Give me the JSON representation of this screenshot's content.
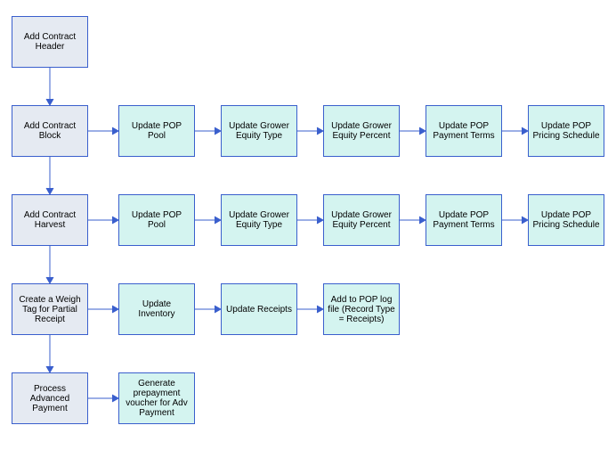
{
  "nodes": {
    "add_contract_header": "Add Contract Header",
    "add_contract_block": "Add Contract Block",
    "add_contract_harvest": "Add Contract Harvest",
    "create_weigh_tag": "Create a Weigh Tag for Partial Receipt",
    "process_adv_payment": "Process Advanced Payment",
    "row2": {
      "update_pop_pool": "Update POP Pool",
      "update_grower_equity_type": "Update Grower Equity Type",
      "update_grower_equity_percent": "Update Grower Equity Percent",
      "update_pop_payment_terms": "Update POP Payment Terms",
      "update_pop_pricing_schedule": "Update POP Pricing Schedule"
    },
    "row3": {
      "update_pop_pool": "Update POP Pool",
      "update_grower_equity_type": "Update Grower Equity Type",
      "update_grower_equity_percent": "Update Grower Equity Percent",
      "update_pop_payment_terms": "Update POP Payment Terms",
      "update_pop_pricing_schedule": "Update POP Pricing Schedule"
    },
    "row4": {
      "update_inventory": "Update Inventory",
      "update_receipts": "Update Receipts",
      "add_to_pop_log": "Add to POP log file (Record Type = Receipts)"
    },
    "row5": {
      "generate_prepayment": "Generate prepayment voucher for Adv Payment"
    }
  }
}
